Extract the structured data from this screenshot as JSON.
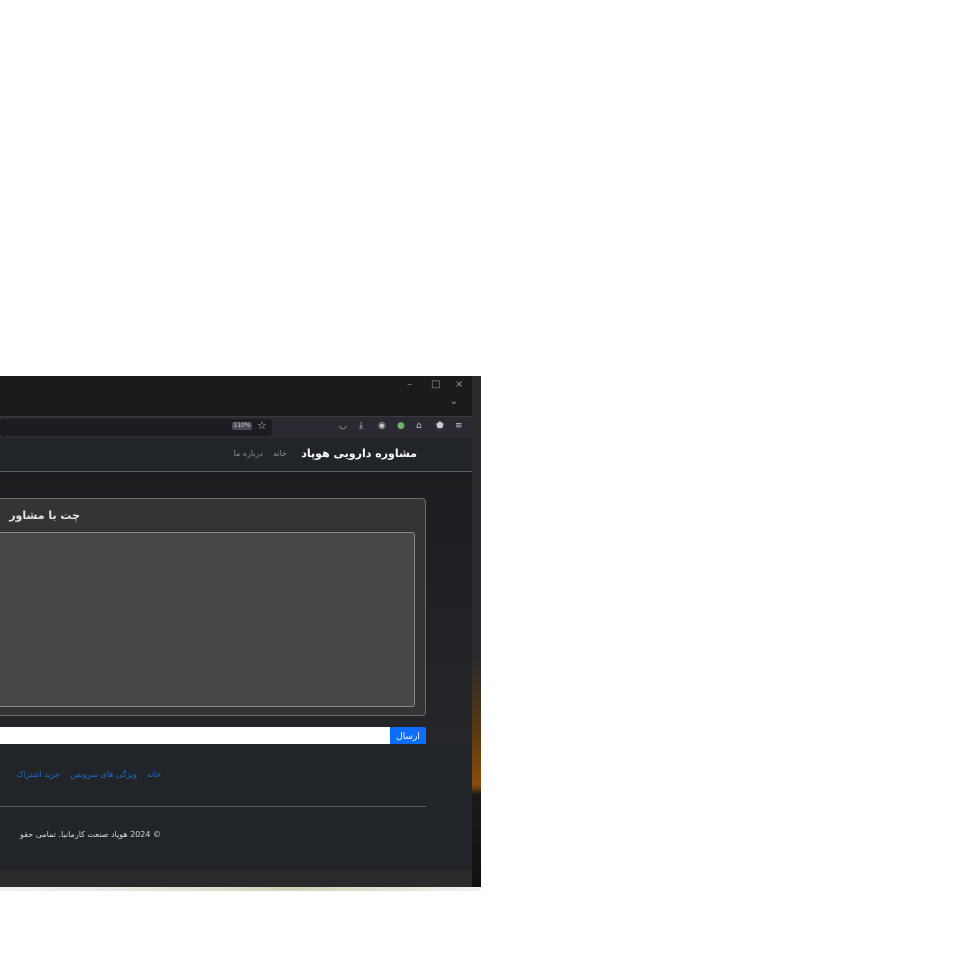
{
  "browser": {
    "zoom_label": "110%",
    "window_controls": {
      "minimize": "–",
      "maximize": "□",
      "close": "×"
    },
    "toolbar_icons": [
      "pocket-icon",
      "download-icon",
      "account-icon",
      "extension-leaf-icon",
      "extension-house-icon",
      "shield-icon",
      "menu-icon"
    ]
  },
  "navbar": {
    "brand": "مشاوره دارویی هوپاد",
    "links": [
      "خانه",
      "درباره ما"
    ]
  },
  "chat": {
    "title": "چت با مشاور",
    "input_value": "",
    "send_label": "ارسال"
  },
  "footer": {
    "links": [
      "خانه",
      "ویژگی های سرویس",
      "خرید اشتراک"
    ],
    "copyright": "© 2024 هوپاد صنعت کارمانیا. تمامی حقو"
  },
  "colors": {
    "accent": "#0d6efd",
    "navbar_bg": "#212529",
    "card_bg": "#343434",
    "chat_box_bg": "#474747",
    "footer_link": "#1f6fcc"
  }
}
